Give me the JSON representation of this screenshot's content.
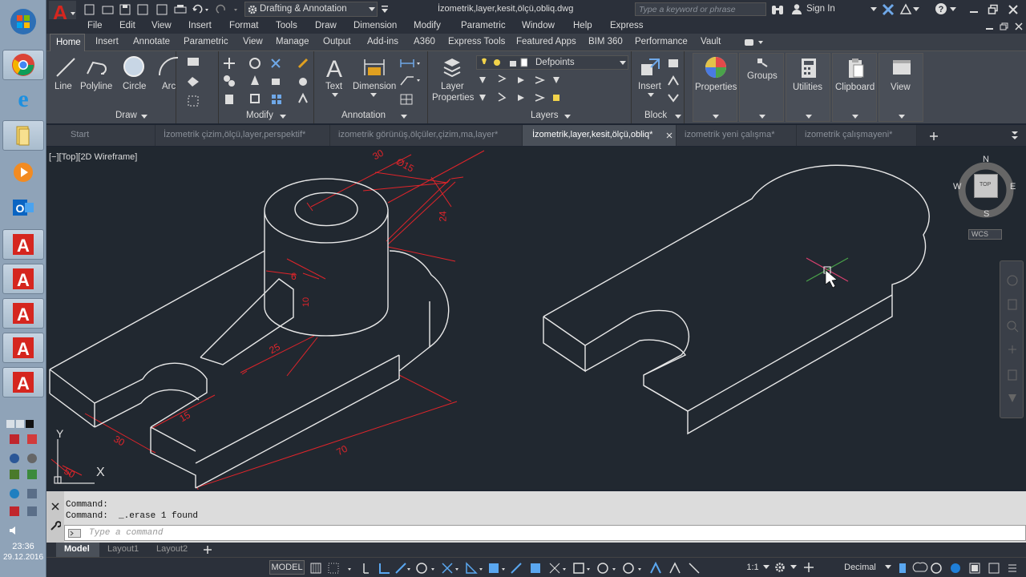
{
  "taskbar": {
    "clock_time": "23:36",
    "clock_date": "29.12.2016",
    "apps": [
      "windows-start",
      "chrome",
      "internet-explorer",
      "file-explorer",
      "media-player",
      "outlook",
      "autocad-1",
      "autocad-2",
      "autocad-3",
      "autocad-4",
      "autocad-5"
    ]
  },
  "titlebar": {
    "workspace": "Drafting & Annotation",
    "document_title": "İzometrik,layer,kesit,ölçü,obliq.dwg",
    "search_placeholder": "Type a keyword or phrase",
    "sign_in": "Sign In"
  },
  "menubar": [
    "File",
    "Edit",
    "View",
    "Insert",
    "Format",
    "Tools",
    "Draw",
    "Dimension",
    "Modify",
    "Parametric",
    "Window",
    "Help",
    "Express"
  ],
  "ribbon_tabs": [
    "Home",
    "Insert",
    "Annotate",
    "Parametric",
    "View",
    "Manage",
    "Output",
    "Add-ins",
    "A360",
    "Express Tools",
    "Featured Apps",
    "BIM 360",
    "Performance",
    "Vault"
  ],
  "ribbon": {
    "draw_tools": [
      "Line",
      "Polyline",
      "Circle",
      "Arc"
    ],
    "panels": [
      "Draw",
      "Modify",
      "Annotation",
      "Layers",
      "Block"
    ],
    "annotation_tools": [
      "Text",
      "Dimension"
    ],
    "layer_tool_line1": "Layer",
    "layer_tool_line2": "Properties",
    "layer_current": "Defpoints",
    "block_tool": "Insert",
    "big_tools": [
      "Properties",
      "Groups",
      "Utilities",
      "Clipboard",
      "View"
    ]
  },
  "doc_tabs": [
    "Start",
    "İzometrik çizim,ölçü,layer,perspektif*",
    "izometrik görünüş,ölçüler,çizim,ma,layer*",
    "İzometrik,layer,kesit,ölçü,obliq*",
    "izometrik yeni çalışma*",
    "izometrik çalışmayeni*"
  ],
  "viewport": {
    "label": "[−][Top][2D Wireframe]",
    "viewcube_face": "TOP",
    "compass": {
      "n": "N",
      "s": "S",
      "e": "E",
      "w": "W"
    },
    "ucs_label": "WCS",
    "ucs_axis_x": "X",
    "ucs_axis_y": "Y",
    "dimensions": {
      "d_top": "30",
      "d_diam": "Ø15",
      "d_height": "24",
      "d_small": "6",
      "d_small2": "10",
      "d_rib": "25",
      "d_slot": "15",
      "d_front": "30",
      "d_length": "70",
      "d_corner": "50"
    }
  },
  "command": {
    "history_line1": "Command:",
    "history_line2": "Command:  _.erase 1 found",
    "input_placeholder": "Type a command"
  },
  "layout_tabs": [
    "Model",
    "Layout1",
    "Layout2"
  ],
  "statusbar": {
    "model": "MODEL",
    "scale": "1:1",
    "units": "Decimal"
  },
  "colors": {
    "accent": "#d5261f",
    "background": "#212830",
    "dimension": "#e0242a",
    "geometry": "#e8e8e8"
  }
}
